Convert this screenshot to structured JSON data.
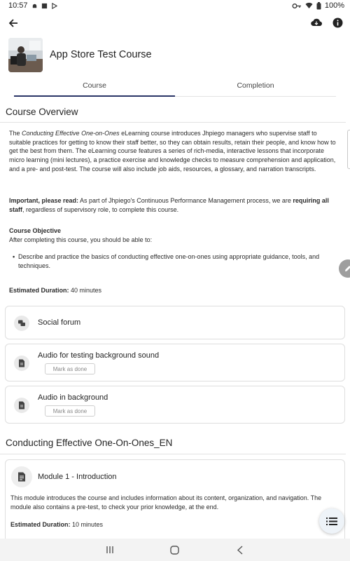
{
  "status_bar": {
    "time": "10:57",
    "battery": "100%"
  },
  "course": {
    "title": "App Store Test Course",
    "tabs": [
      {
        "label": "Course",
        "active": true
      },
      {
        "label": "Completion",
        "active": false
      }
    ]
  },
  "overview": {
    "title": "Course Overview",
    "summary_parts": {
      "p1_before": "The ",
      "p1_italic": "Conducting Effective One-on-Ones",
      "p1_after": " eLearning course introduces Jhpiego managers who supervise staff to suitable practices for getting to know their staff better, so they can obtain results, retain their people, and know how to get the best from them. The eLearning course features a series of rich-media, interactive lessons that incorporate micro learning (mini lectures), a practice exercise and knowledge checks to measure comprehension and application, and a pre- and post-test. The course will also include job aids, resources, a glossary, and narration transcripts.",
      "p2_bold": "Important, please read:",
      "p2_mid": " As part of Jhpiego's Continuous Performance Management process, we are ",
      "p2_bold2": "requiring all staff",
      "p2_after": ", regardless of supervisory role, to complete this course.",
      "objective_heading": "Course Objective",
      "objective_intro": "After completing this course, you should be able to:",
      "objective_bullet": "Describe and practice the basics of conducting effective one-on-ones using appropriate guidance, tools, and techniques.",
      "duration_label": "Estimated Duration:",
      "duration_value": " 40 minutes"
    }
  },
  "activities": [
    {
      "name": "Social forum",
      "icon": "forum-icon",
      "mark_done": null
    },
    {
      "name": "Audio for testing background sound",
      "icon": "file-icon",
      "mark_done": "Mark as done"
    },
    {
      "name": "Audio in background",
      "icon": "file-icon",
      "mark_done": "Mark as done"
    }
  ],
  "section2": {
    "title": "Conducting Effective One-On-Ones_EN",
    "module": {
      "name": "Module 1 - Introduction",
      "icon": "page-icon",
      "description": "This module introduces the course and includes information about its content, organization, and navigation. The module also contains a pre-test, to check your prior knowledge, at the end.",
      "duration_label": "Estimated Duration:",
      "duration_value": " 10 minutes"
    }
  },
  "colors": {
    "tab_indicator": "#2a3566",
    "fab_bg": "#eef3f8",
    "edit_fab": "#9e9e9e"
  }
}
